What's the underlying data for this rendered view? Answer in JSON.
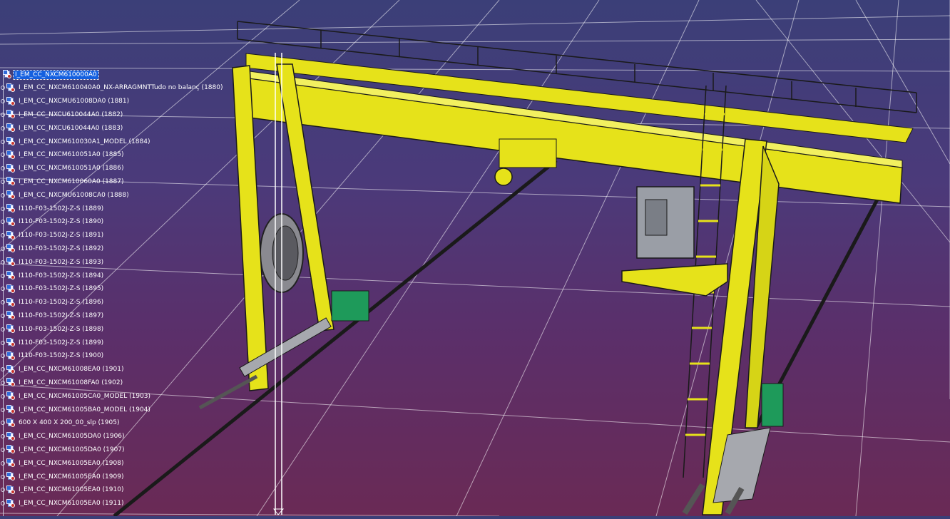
{
  "tree": {
    "root": "I_EM_CC_NXCM610000A0",
    "items": [
      "I_EM_CC_NXCM610040A0_NX-ARRAGMNTTudo no balanç (1880)",
      "I_EM_CC_NXCMU61008DA0 (1881)",
      "I_EM_CC_NXCU610044A0 (1882)",
      "I_EM_CC_NXCU610044A0 (1883)",
      "I_EM_CC_NXCM610030A1_MODEL (1884)",
      "I_EM_CC_NXCM610051A0 (1885)",
      "I_EM_CC_NXCM610051A0 (1886)",
      "I_EM_CC_NXCM610060A0 (1887)",
      "I_EM_CC_NXCMU61008CA0 (1888)",
      "I110-F03-1502J-Z-S (1889)",
      "I110-F03-1502J-Z-S (1890)",
      "I110-F03-1502J-Z-S (1891)",
      "I110-F03-1502J-Z-S (1892)",
      "I110-F03-1502J-Z-S (1893)",
      "I110-F03-1502J-Z-S (1894)",
      "I110-F03-1502J-Z-S (1895)",
      "I110-F03-1502J-Z-S (1896)",
      "I110-F03-1502J-Z-S (1897)",
      "I110-F03-1502J-Z-S (1898)",
      "I110-F03-1502J-Z-S (1899)",
      "I110-F03-1502J-Z-S (1900)",
      "I_EM_CC_NXCM61008EA0 (1901)",
      "I_EM_CC_NXCM61008FA0 (1902)",
      "I_EM_CC_NXCM61005CA0_MODEL (1903)",
      "I_EM_CC_NXCM61005BA0_MODEL (1904)",
      "600 X 400 X 200_00_slp (1905)",
      "I_EM_CC_NXCM61005DA0 (1906)",
      "I_EM_CC_NXCM61005DA0 (1907)",
      "I_EM_CC_NXCM61005EA0 (1908)",
      "I_EM_CC_NXCM61005EA0 (1909)",
      "I_EM_CC_NXCM61005EA0 (1910)",
      "I_EM_CC_NXCM61005EA0 (1911)"
    ]
  },
  "colors": {
    "crane_yellow": "#e6e21a",
    "motor_green": "#1e9a5a",
    "grid_line": "#ffffff",
    "selection": "#1460e0"
  },
  "icons": [
    "product-icon",
    "part-icon",
    "expander-icon"
  ]
}
